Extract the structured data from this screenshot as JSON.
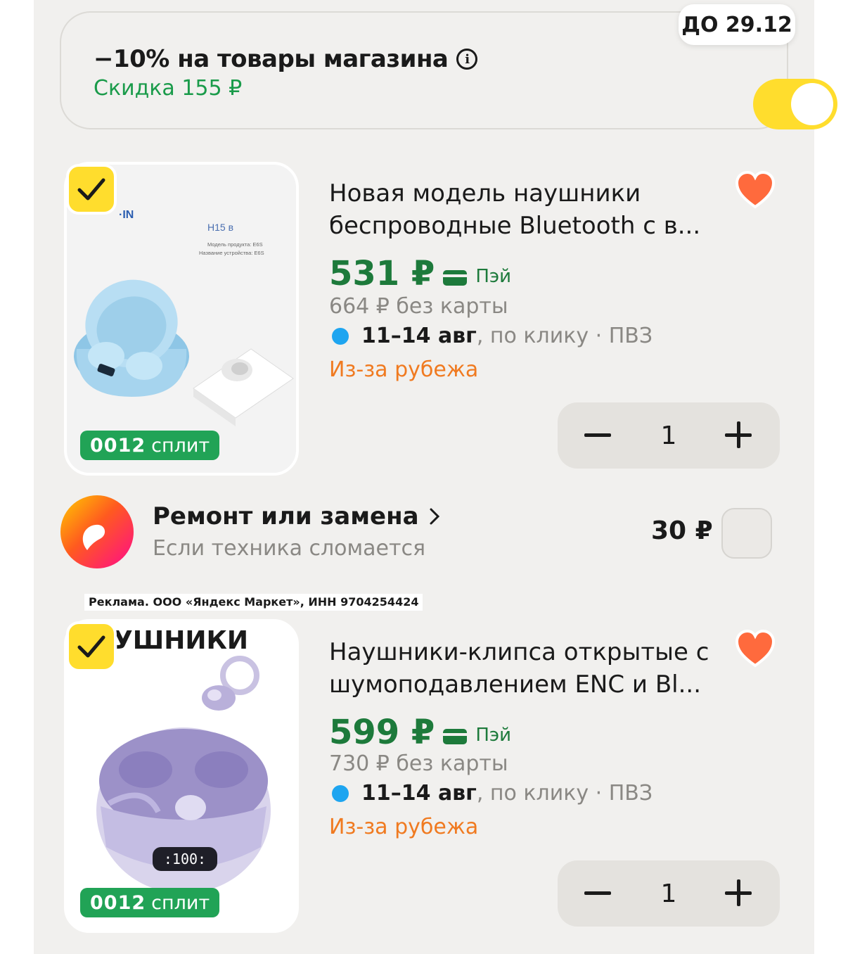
{
  "promo": {
    "title": "−10% на товары магазина",
    "info_icon": "info-icon",
    "subtitle": "Скидка 155 ₽",
    "badge": "ДО 29.12",
    "toggle_on": true,
    "accent": "#ffdd2d"
  },
  "products": [
    {
      "title_line1": "Новая модель наушники",
      "title_line2": "беспроводные Bluetooth с в...",
      "price": "531 ₽",
      "pay_label": "Пэй",
      "old_price": "664 ₽ без карты",
      "delivery_date": "11–14 авг",
      "delivery_rest": ", по клику · ПВЗ",
      "origin": "Из-за рубежа",
      "quantity": "1",
      "split_dots": "0012",
      "split_label": "сплит",
      "image_texts": {
        "brand": "·IN",
        "model": "H15 в",
        "line1": "Модель продукта: E6S",
        "line2": "Название устройства: E6S"
      }
    },
    {
      "title_line1": "Наушники-клипса открытые с",
      "title_line2": "шумоподавлением ENC и Bl...",
      "price": "599 ₽",
      "pay_label": "Пэй",
      "old_price": "730 ₽ без карты",
      "delivery_date": "11–14 авг",
      "delivery_rest": ", по клику · ПВЗ",
      "origin": "Из-за рубежа",
      "quantity": "1",
      "split_dots": "0012",
      "split_label": "сплит",
      "image_texts": {
        "heading": "УШНИКИ"
      }
    }
  ],
  "repair": {
    "title": "Ремонт или замена",
    "subtitle": "Если техника сломается",
    "price": "30 ₽"
  },
  "ad_disclaimer": "Реклама. ООО «Яндекс Маркет», ИНН 9704254424",
  "colors": {
    "price_green": "#1d7a3b",
    "discount_green": "#1a9b4a",
    "origin_orange": "#f07a20",
    "delivery_dot": "#1ea5f0",
    "heart": "#ff6a3d"
  }
}
